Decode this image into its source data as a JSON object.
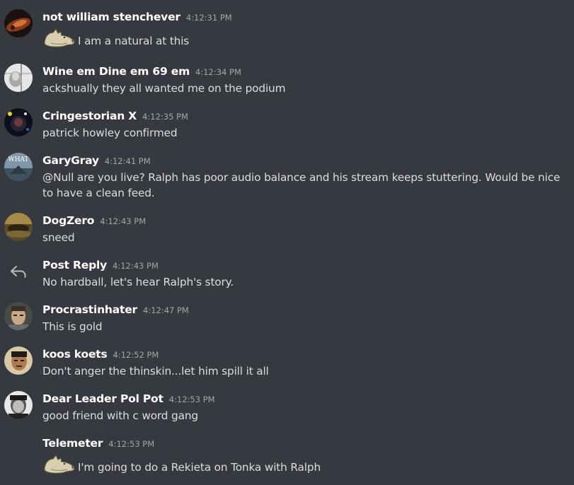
{
  "messages": [
    {
      "username": "not william stenchever",
      "time": "4:12:31 PM",
      "text": "I am a natural at this",
      "emote": "doge-emote"
    },
    {
      "username": "Wine em Dine em 69 em",
      "time": "4:12:34 PM",
      "text": "ackshually they all wanted me on the podium"
    },
    {
      "username": "Cringestorian X",
      "time": "4:12:35 PM",
      "text": "patrick howley confirmed"
    },
    {
      "username": "GaryGray",
      "time": "4:12:41 PM",
      "text": "@Null are you live? Ralph has poor audio balance and his stream keeps stuttering. Would be nice to have a clean feed."
    },
    {
      "username": "DogZero",
      "time": "4:12:43 PM",
      "text": "sneed"
    },
    {
      "username": "Post Reply",
      "time": "4:12:43 PM",
      "text": "No hardball, let's hear Ralph's story."
    },
    {
      "username": "Procrastinhater",
      "time": "4:12:47 PM",
      "text": "This is gold"
    },
    {
      "username": "koos koets",
      "time": "4:12:52 PM",
      "text": "Don't anger the thinskin...let him spill it all"
    },
    {
      "username": "Dear Leader Pol Pot",
      "time": "4:12:53 PM",
      "text": "good friend with c word gang"
    },
    {
      "username": "Telemeter",
      "time": "4:12:53 PM",
      "text": "I'm going to do a Rekieta on Tonka with Ralph",
      "emote": "doge-emote"
    }
  ],
  "avatar_overlay_text": "WHAT",
  "icons": {
    "reply": "reply-arrow-icon",
    "emote": "doge-emote"
  },
  "colors": {
    "background": "#36393f",
    "username": "#ffffff",
    "text": "#dcddde",
    "timestamp": "#a3a6aa"
  }
}
